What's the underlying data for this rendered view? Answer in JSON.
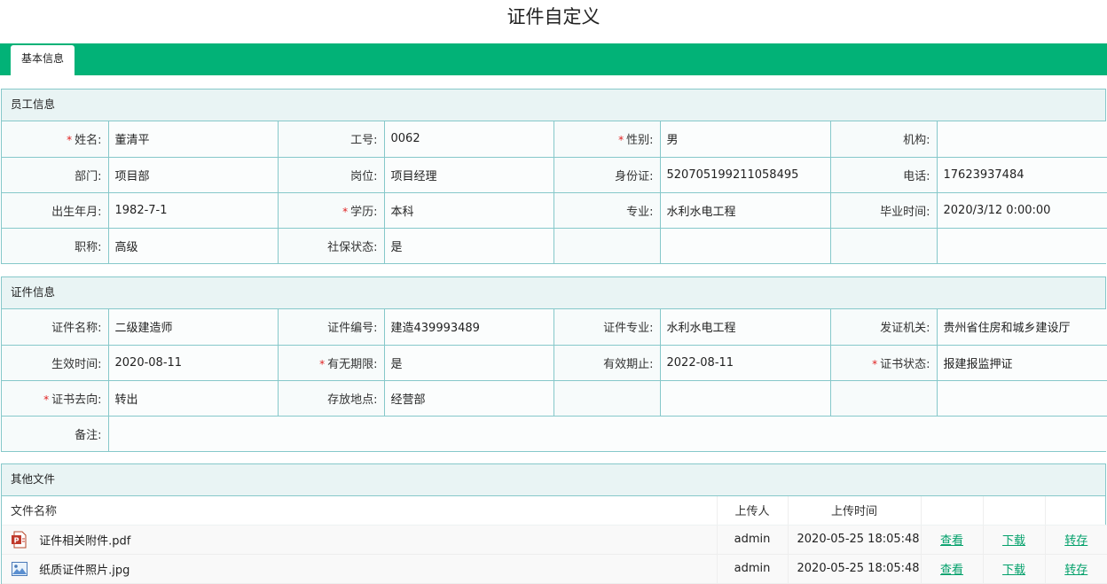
{
  "page": {
    "title": "证件自定义"
  },
  "tabs": [
    {
      "label": "基本信息"
    }
  ],
  "employee": {
    "header": "员工信息",
    "rows": [
      [
        {
          "label": "姓名:",
          "value": "董清平",
          "required": true
        },
        {
          "label": "工号:",
          "value": "0062",
          "required": false
        },
        {
          "label": "性别:",
          "value": "男",
          "required": true
        },
        {
          "label": "机构:",
          "value": "",
          "required": false
        }
      ],
      [
        {
          "label": "部门:",
          "value": "项目部",
          "required": false
        },
        {
          "label": "岗位:",
          "value": "项目经理",
          "required": false
        },
        {
          "label": "身份证:",
          "value": "520705199211058495",
          "required": false
        },
        {
          "label": "电话:",
          "value": "17623937484",
          "required": false
        }
      ],
      [
        {
          "label": "出生年月:",
          "value": "1982-7-1",
          "required": false
        },
        {
          "label": "学历:",
          "value": "本科",
          "required": true
        },
        {
          "label": "专业:",
          "value": "水利水电工程",
          "required": false
        },
        {
          "label": "毕业时间:",
          "value": "2020/3/12 0:00:00",
          "required": false
        }
      ],
      [
        {
          "label": "职称:",
          "value": "高级",
          "required": false
        },
        {
          "label": "社保状态:",
          "value": "是",
          "required": false
        },
        {
          "label": "",
          "value": "",
          "required": false
        },
        {
          "label": "",
          "value": "",
          "required": false
        }
      ]
    ]
  },
  "certificate": {
    "header": "证件信息",
    "rows": [
      [
        {
          "label": "证件名称:",
          "value": "二级建造师",
          "required": false
        },
        {
          "label": "证件编号:",
          "value": "建造439993489",
          "required": false
        },
        {
          "label": "证件专业:",
          "value": "水利水电工程",
          "required": false
        },
        {
          "label": "发证机关:",
          "value": "贵州省住房和城乡建设厅",
          "required": false
        }
      ],
      [
        {
          "label": "生效时间:",
          "value": "2020-08-11",
          "required": false
        },
        {
          "label": "有无期限:",
          "value": "是",
          "required": true
        },
        {
          "label": "有效期止:",
          "value": "2022-08-11",
          "required": false
        },
        {
          "label": "证书状态:",
          "value": "报建报监押证",
          "required": true
        }
      ],
      [
        {
          "label": "证书去向:",
          "value": "转出",
          "required": true
        },
        {
          "label": "存放地点:",
          "value": "经营部",
          "required": false
        },
        {
          "label": "",
          "value": "",
          "required": false
        },
        {
          "label": "",
          "value": "",
          "required": false
        }
      ]
    ],
    "remark": {
      "label": "备注:",
      "value": ""
    }
  },
  "files": {
    "header": "其他文件",
    "columns": {
      "name": "文件名称",
      "uploader": "上传人",
      "time": "上传时间"
    },
    "actions": {
      "view": "查看",
      "download": "下载",
      "save": "转存"
    },
    "rows": [
      {
        "name": "证件相关附件.pdf",
        "icon": "pdf-file-icon",
        "uploader": "admin",
        "time": "2020-05-25 18:05:48"
      },
      {
        "name": "纸质证件照片.jpg",
        "icon": "image-file-icon",
        "uploader": "admin",
        "time": "2020-05-25 18:05:48"
      }
    ]
  },
  "colors": {
    "accent": "#02b277",
    "border": "#86c8ca",
    "header_bg": "#e9f4f4",
    "required": "#e02020",
    "link": "#02a06a"
  }
}
